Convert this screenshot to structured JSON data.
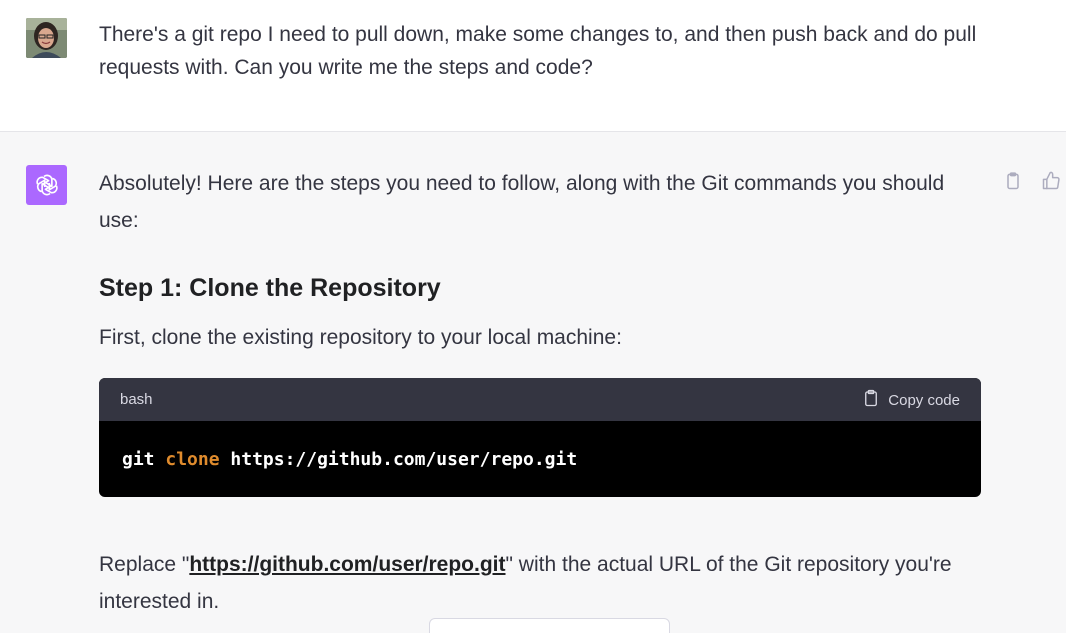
{
  "user_message": {
    "text": "There's a git repo I need to pull down, make some changes to, and then push back and do pull requests with. Can you write me the steps and code?"
  },
  "assistant_message": {
    "intro": "Absolutely! Here are the steps you need to follow, along with the Git commands you should use:",
    "step1_heading": "Step 1: Clone the Repository",
    "step1_text": "First, clone the existing repository to your local machine:",
    "code_block": {
      "language": "bash",
      "copy_label": "Copy code",
      "cmd": "git",
      "subcmd": "clone",
      "arg": "https://github.com/user/repo.git"
    },
    "replace_prefix": "Replace \"",
    "replace_link": "https://github.com/user/repo.git",
    "replace_suffix": "\" with the actual URL of the Git repository you're interested in."
  },
  "icons": {
    "copy": "clipboard-icon",
    "like": "thumbs-up-icon",
    "assistant_avatar": "openai-logo-icon"
  },
  "colors": {
    "assistant_bg": "#f7f7f8",
    "avatar_purple": "#ab68ff",
    "code_header": "#343541",
    "keyword_orange": "#df8b2d"
  }
}
